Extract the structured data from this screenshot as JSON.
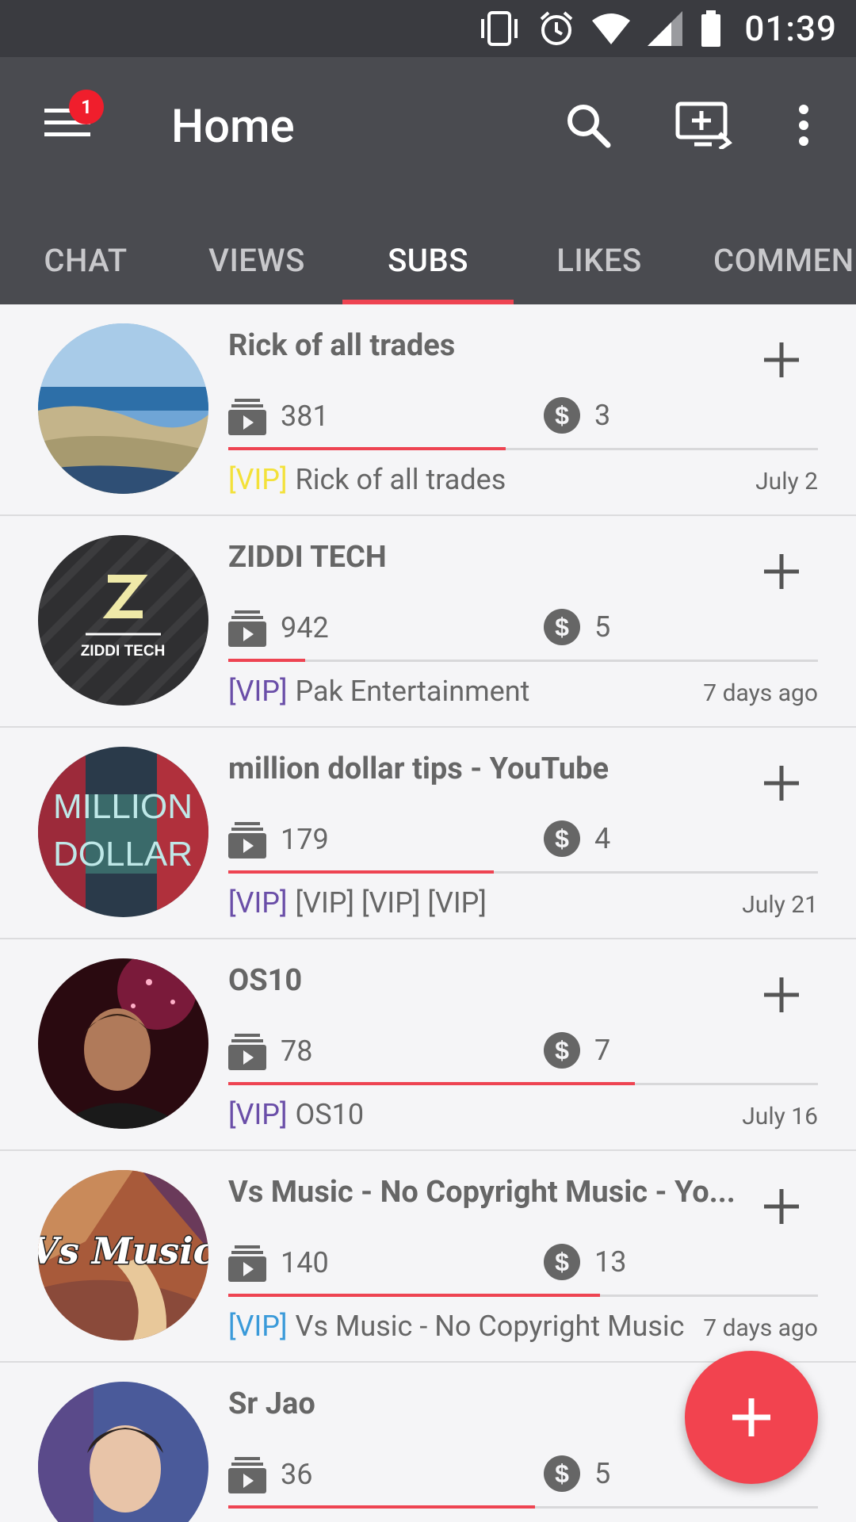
{
  "status_bar": {
    "time": "01:39"
  },
  "app_bar": {
    "title": "Home",
    "notification_count": "1"
  },
  "tabs": [
    {
      "label": "CHAT"
    },
    {
      "label": "VIEWS"
    },
    {
      "label": "SUBS"
    },
    {
      "label": "LIKES"
    },
    {
      "label": "COMMEN"
    }
  ],
  "active_tab": "SUBS",
  "items": [
    {
      "title": "Rick of all trades",
      "views": "381",
      "coins": "3",
      "progress": 0.47,
      "vip": "[VIP]",
      "vip_color": "#f3e13a",
      "desc": "Rick of all trades",
      "date": "July 2"
    },
    {
      "title": "ZIDDI TECH",
      "views": "942",
      "coins": "5",
      "progress": 0.13,
      "vip": "[VIP]",
      "vip_color": "#6a4ea8",
      "desc": "Pak Entertainment",
      "date": "7 days ago"
    },
    {
      "title": "million dollar tips - YouTube",
      "views": "179",
      "coins": "4",
      "progress": 0.45,
      "vip": "[VIP]",
      "vip_color": "#6a4ea8",
      "desc": "[VIP] [VIP] [VIP]",
      "date": "July 21"
    },
    {
      "title": "OS10",
      "views": "78",
      "coins": "7",
      "progress": 0.69,
      "vip": "[VIP]",
      "vip_color": "#6a4ea8",
      "desc": "OS10",
      "date": "July 16"
    },
    {
      "title": "Vs Music - No Copyright Music - Yo...",
      "views": "140",
      "coins": "13",
      "progress": 0.63,
      "vip": "[VIP]",
      "vip_color": "#3a9ad9",
      "desc": "Vs Music - No Copyright Music",
      "date": "7 days ago"
    },
    {
      "title": "Sr Jao",
      "views": "36",
      "coins": "5",
      "progress": 0.52,
      "vip": "",
      "vip_color": "#6a4ea8",
      "desc": "",
      "date": ""
    }
  ],
  "avatar_text": {
    "ziddi": "ZIDDI TECH",
    "million": "MILLION",
    "dollar": "DOLLAR",
    "vsmusic": "Vs Music"
  },
  "colors": {
    "accent": "#ee4452",
    "app_bar": "#4a4b50",
    "status_bar": "#3a3b40"
  }
}
